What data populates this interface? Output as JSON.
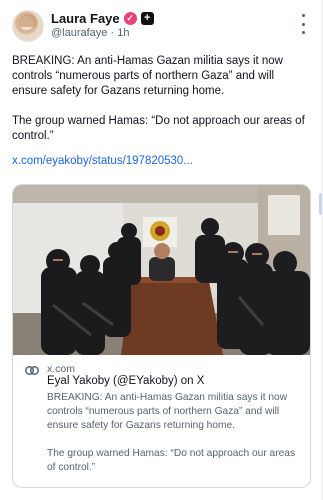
{
  "author": {
    "display_name": "Laura Faye",
    "verified_icon": "verified-check-icon",
    "plus_icon": "plus-icon",
    "handle": "@laurafaye",
    "separator": "·",
    "time": "1h"
  },
  "post": {
    "paragraph_1": "BREAKING: An anti-Hamas Gazan militia says it now controls “numerous parts of northern Gaza” and will ensure safety for Gazans returning home.",
    "paragraph_2": "The group warned Hamas: “Do not approach our areas of control.”",
    "link_text": "x.com/eyakoby/status/197820530..."
  },
  "card": {
    "domain": "x.com",
    "title": "Eyal Yakoby (@EYakoby) on X",
    "description_1": "BREAKING: An anti-Hamas Gazan militia says it now controls “numerous parts of northern Gaza” and will ensure safety for Gazans returning home.",
    "description_2": "The group warned Hamas: “Do not approach our areas of control.”"
  },
  "colors": {
    "link": "#1d63d8",
    "verified_badge": "#e8437a",
    "muted_text": "#536471",
    "card_border": "#cfd9de"
  }
}
